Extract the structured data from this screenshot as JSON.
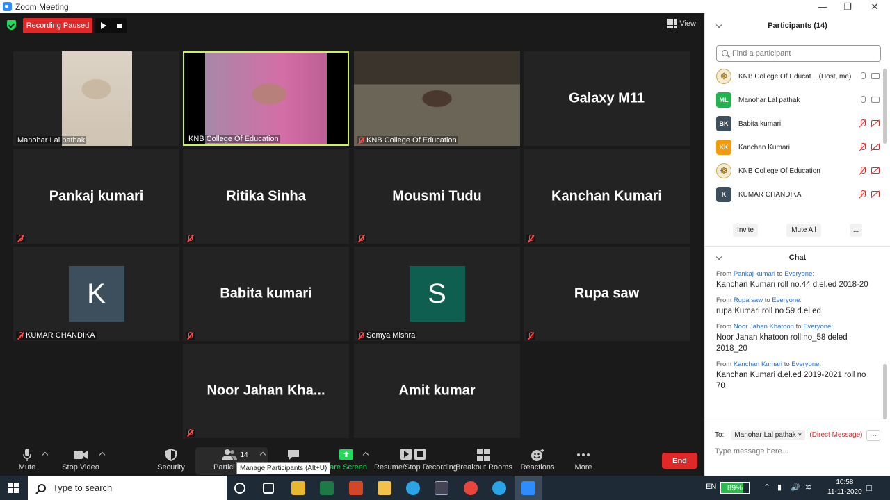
{
  "window": {
    "title": "Zoom Meeting"
  },
  "recording": {
    "status": "Recording Paused"
  },
  "view_label": "View",
  "tiles": [
    {
      "name": "Manohar Lal pathak",
      "caption": "Manohar Lal pathak",
      "video": true,
      "muted": false
    },
    {
      "name": "KNB College Of Education",
      "caption": "KNB College Of Education",
      "video": true,
      "muted": false,
      "active": true
    },
    {
      "name": "KNB College Of Education",
      "caption": "KNB College Of Education",
      "video": true,
      "muted": true
    },
    {
      "name": "Galaxy M11",
      "caption": "",
      "video": false,
      "muted": false
    },
    {
      "name": "Pankaj  kumari",
      "caption": "",
      "video": false,
      "muted": true
    },
    {
      "name": "Ritika Sinha",
      "caption": "",
      "video": false,
      "muted": true
    },
    {
      "name": "Mousmi Tudu",
      "caption": "",
      "video": false,
      "muted": true
    },
    {
      "name": "Kanchan Kumari",
      "caption": "",
      "video": false,
      "muted": true
    },
    {
      "name": "K",
      "caption": "KUMAR CHANDIKA",
      "video": false,
      "muted": true,
      "avatar_color": "#3d4f5c"
    },
    {
      "name": "Babita kumari",
      "caption": "",
      "video": false,
      "muted": true
    },
    {
      "name": "S",
      "caption": "Somya Mishra",
      "video": false,
      "muted": true,
      "avatar_color": "#0e5f4f"
    },
    {
      "name": "Rupa saw",
      "caption": "",
      "video": false,
      "muted": true
    },
    {
      "name": "Noor Jahan Kha...",
      "caption": "",
      "video": false,
      "muted": true
    },
    {
      "name": "Amit kumar",
      "caption": "",
      "video": false,
      "muted": false
    }
  ],
  "toolbar": {
    "mute": "Mute",
    "stop_video": "Stop Video",
    "security": "Security",
    "participants": "Partici",
    "participants_count": "14",
    "chat": "",
    "share_screen": "hare Screen",
    "recording": "Resume/Stop Recording",
    "breakout": "Breakout Rooms",
    "reactions": "Reactions",
    "more": "More",
    "end": "End",
    "tooltip": "Manage Participants (Alt+U)"
  },
  "participants_panel": {
    "title": "Participants (14)",
    "search_placeholder": "Find a participant",
    "items": [
      {
        "initials": "",
        "name": "KNB College Of Educat... (Host, me)",
        "avatar": "logo",
        "mic": "on",
        "cam": "on"
      },
      {
        "initials": "ML",
        "name": "Manohar Lal pathak",
        "color": "#23b34e",
        "mic": "on",
        "cam": "on"
      },
      {
        "initials": "BK",
        "name": "Babita kumari",
        "color": "#3d4f5c",
        "mic": "off",
        "cam": "off"
      },
      {
        "initials": "KK",
        "name": "Kanchan Kumari",
        "color": "#f39b0b",
        "mic": "off",
        "cam": "off"
      },
      {
        "initials": "",
        "name": "KNB College Of Education",
        "avatar": "logo",
        "mic": "off",
        "cam": "off"
      },
      {
        "initials": "K",
        "name": "KUMAR CHANDIKA",
        "color": "#3d4f5c",
        "mic": "off",
        "cam": "off"
      }
    ],
    "invite": "Invite",
    "mute_all": "Mute All",
    "more": "..."
  },
  "chat": {
    "title": "Chat",
    "messages": [
      {
        "from_label": "From",
        "from": "Pankaj  kumari",
        "to_label": "to",
        "to": "Everyone:",
        "text": "Kanchan Kumari roll no.44 d.el.ed 2018-20"
      },
      {
        "from_label": "From",
        "from": "Rupa saw",
        "to_label": "to",
        "to": "Everyone:",
        "text": "rupa Kumari roll no 59 d.el.ed"
      },
      {
        "from_label": "From",
        "from": "Noor Jahan Khatoon",
        "to_label": "to",
        "to": "Everyone:",
        "text": "Noor Jahan khatoon roll no_58 deled 2018_20"
      },
      {
        "from_label": "From",
        "from": "Kanchan Kumari",
        "to_label": "to",
        "to": "Everyone:",
        "text": "Kanchan Kumari d.el.ed 2019-2021 roll no 70"
      }
    ],
    "to_label": "To:",
    "recipient": "Manohar Lal pathak",
    "direct": "(Direct Message)",
    "more": "···",
    "placeholder": "Type message here..."
  },
  "taskbar": {
    "search_placeholder": "Type to search",
    "language": "EN",
    "battery": "89%",
    "time": "10:58",
    "date": "11-11-2020"
  },
  "colors": {
    "accent": "#2d8cff",
    "danger": "#e02828",
    "active_border": "#c7f553"
  }
}
